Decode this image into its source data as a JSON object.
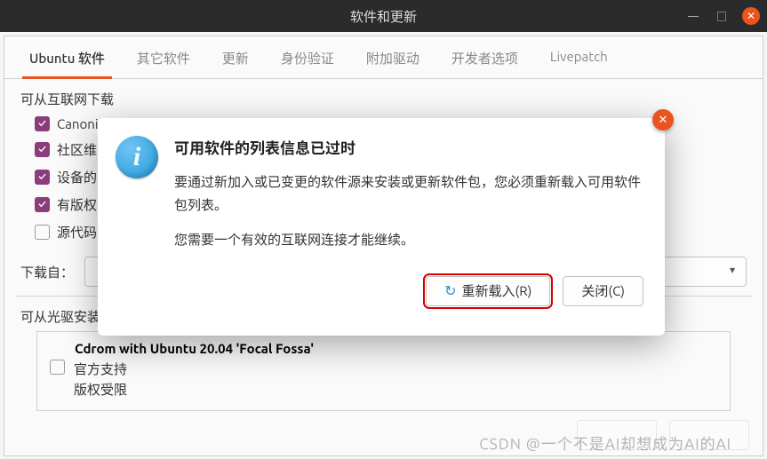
{
  "window": {
    "title": "软件和更新"
  },
  "tabs": [
    {
      "label": "Ubuntu 软件",
      "active": true
    },
    {
      "label": "其它软件",
      "active": false
    },
    {
      "label": "更新",
      "active": false
    },
    {
      "label": "身份验证",
      "active": false
    },
    {
      "label": "附加驱动",
      "active": false
    },
    {
      "label": "开发者选项",
      "active": false
    },
    {
      "label": "Livepatch",
      "active": false
    }
  ],
  "section1": {
    "title": "可从互联网下载",
    "items": [
      {
        "label": "Canoni",
        "checked": true
      },
      {
        "label": "社区维",
        "checked": true
      },
      {
        "label": "设备的",
        "checked": true
      },
      {
        "label": "有版权",
        "checked": true
      },
      {
        "label": "源代码",
        "checked": false
      }
    ]
  },
  "download": {
    "label": "下载自："
  },
  "section2": {
    "title": "可从光驱安装",
    "cd_title": "Cdrom with Ubuntu 20.04 'Focal Fossa'",
    "cd_sub1": "官方支持",
    "cd_sub2": "版权受限",
    "checked": false
  },
  "modal": {
    "title": "可用软件的列表信息已过时",
    "line1": "要通过新加入或已变更的软件源来安装或更新软件包，您必须重新载入可用软件包列表。",
    "line2": "您需要一个有效的互联网连接才能继续。",
    "reload": "重新载入(R)",
    "close": "关闭(C)"
  },
  "watermark": "CSDN @一个不是AI却想成为AI的AI"
}
